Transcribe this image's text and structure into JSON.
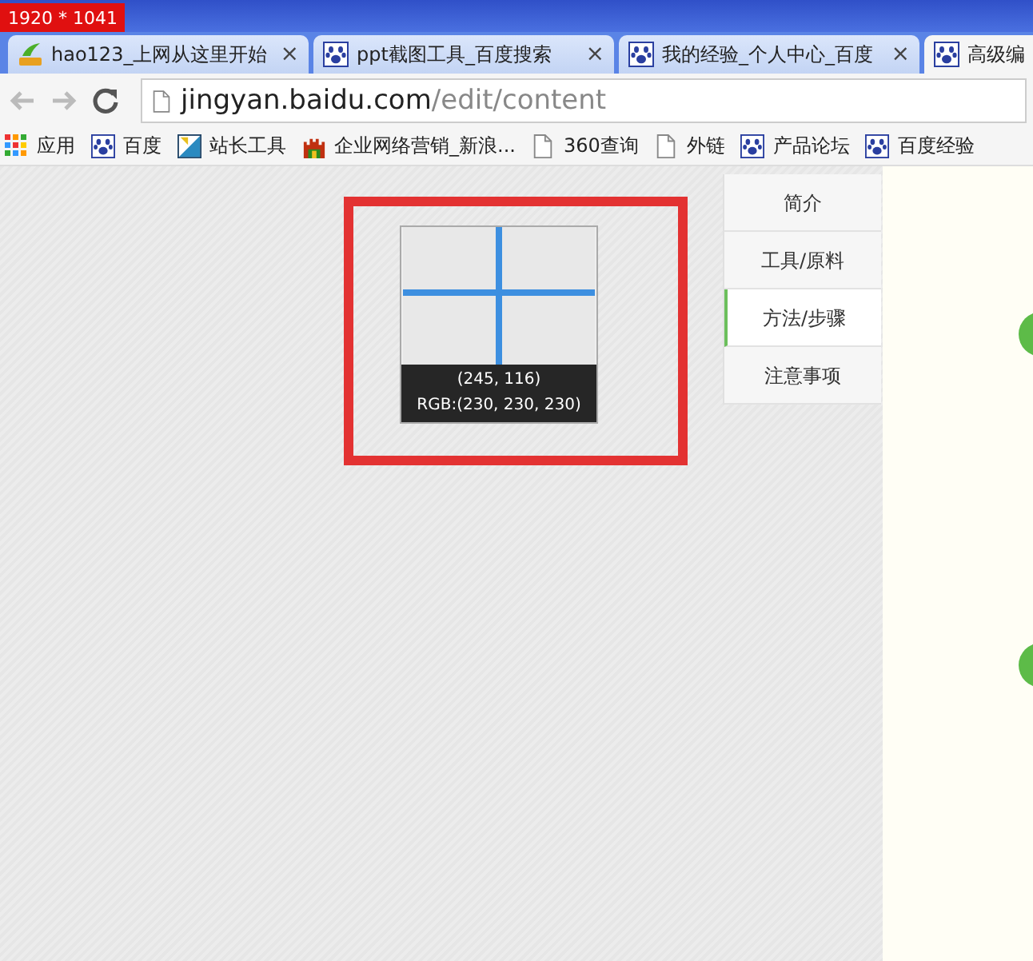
{
  "screen_label": "1920 * 1041",
  "tabs": [
    {
      "title": "hao123_上网从这里开始",
      "kind": "hao",
      "close": "×",
      "selected": false
    },
    {
      "title": "ppt截图工具_百度搜索",
      "kind": "paw",
      "close": "×",
      "selected": false
    },
    {
      "title": "我的经验_个人中心_百度",
      "kind": "paw",
      "close": "×",
      "selected": false
    },
    {
      "title": "高级编",
      "kind": "paw",
      "selected": true
    }
  ],
  "address": {
    "host": "jingyan.baidu.com",
    "path": "/edit/content"
  },
  "bookmarks": [
    {
      "label": "应用",
      "kind": "apps"
    },
    {
      "label": "百度",
      "kind": "paw"
    },
    {
      "label": "站长工具",
      "kind": "tool"
    },
    {
      "label": "企业网络营销_新浪...",
      "kind": "castle"
    },
    {
      "label": "360查询",
      "kind": "page"
    },
    {
      "label": "外链",
      "kind": "page"
    },
    {
      "label": "产品论坛",
      "kind": "paw"
    },
    {
      "label": "百度经验",
      "kind": "paw"
    }
  ],
  "magnifier": {
    "coords": "(245, 116)",
    "rgb": "RGB:(230, 230, 230)"
  },
  "outline_nav": [
    {
      "label": "简介",
      "selected": false
    },
    {
      "label": "工具/原料",
      "selected": false
    },
    {
      "label": "方法/步骤",
      "selected": true
    },
    {
      "label": "注意事项",
      "selected": false
    }
  ]
}
